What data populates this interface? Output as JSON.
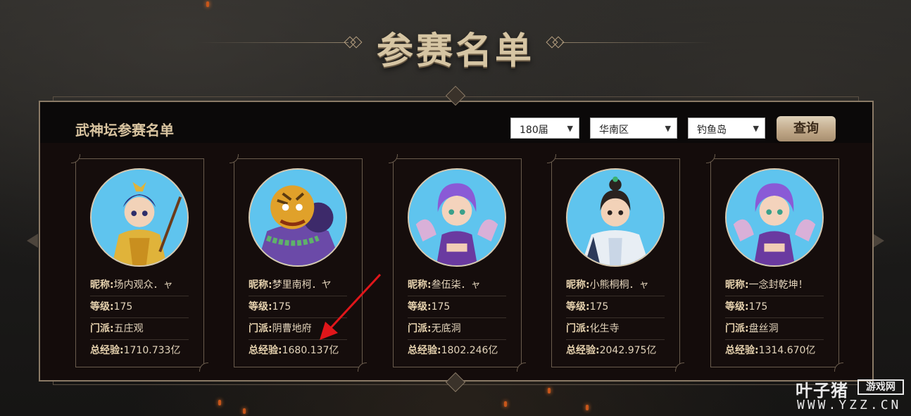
{
  "page": {
    "title": "参赛名单"
  },
  "panel": {
    "title": "武神坛参赛名单"
  },
  "filters": {
    "season": "180届",
    "region": "华南区",
    "server": "钓鱼岛",
    "query_label": "查询"
  },
  "labels": {
    "nickname": "昵称:",
    "level": "等级:",
    "school": "门派:",
    "exp": "总经验:"
  },
  "players": [
    {
      "nickname": "场内观众．ャ",
      "level": "175",
      "school": "五庄观",
      "exp": "1710.733亿",
      "avatar": "golden-armored-hero-avatar"
    },
    {
      "nickname": "梦里南柯．ヤ",
      "level": "175",
      "school": "阴曹地府",
      "exp": "1680.137亿",
      "avatar": "tiger-beast-avatar"
    },
    {
      "nickname": "叁伍柒．ャ",
      "level": "175",
      "school": "无底洞",
      "exp": "1802.246亿",
      "avatar": "purple-hair-girl-avatar"
    },
    {
      "nickname": "小熊桐桐．ャ",
      "level": "175",
      "school": "化生寺",
      "exp": "2042.975亿",
      "avatar": "white-robe-boy-avatar"
    },
    {
      "nickname": "一念封乾坤！",
      "level": "175",
      "school": "盘丝洞",
      "exp": "1314.670亿",
      "avatar": "purple-hair-girl-avatar"
    }
  ],
  "watermark": {
    "brand": "叶子猪",
    "tag": "游戏网",
    "url": "WWW.YZZ.CN"
  },
  "colors": {
    "accent": "#d9c4a0",
    "panel_bg": "#140c0b",
    "annotation": "#e0161a"
  }
}
